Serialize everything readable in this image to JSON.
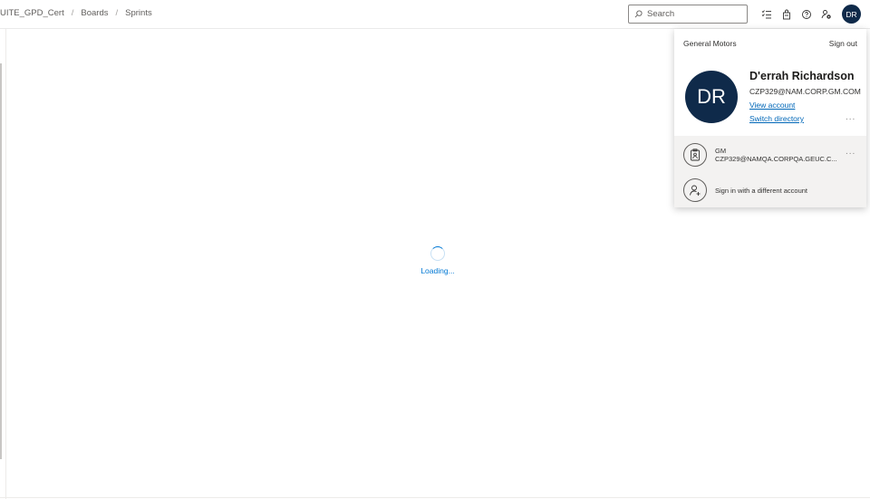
{
  "breadcrumb": {
    "items": [
      "UITE_GPD_Cert",
      "Boards",
      "Sprints"
    ],
    "separator": "/"
  },
  "search": {
    "placeholder": "Search",
    "value": ""
  },
  "header_icons": [
    "search-icon",
    "task-list-icon",
    "shopping-bag-icon",
    "help-icon",
    "user-settings-icon"
  ],
  "user": {
    "initials": "DR"
  },
  "loading": {
    "text": "Loading..."
  },
  "account_panel": {
    "org_name": "General Motors",
    "sign_out_label": "Sign out",
    "initials": "DR",
    "name": "D'errah Richardson",
    "email": "CZP329@NAM.CORP.GM.COM",
    "view_account_label": "View account",
    "switch_directory_label": "Switch directory",
    "more_label": "...",
    "other_account": {
      "org": "GM",
      "email": "CZP329@NAMQA.CORPQA.GEUC.C...",
      "more_label": "..."
    },
    "sign_in_other_label": "Sign in with a different account"
  },
  "colors": {
    "accent": "#0078d4",
    "link": "#0067b8",
    "avatar_bg": "#0f2a4a"
  }
}
